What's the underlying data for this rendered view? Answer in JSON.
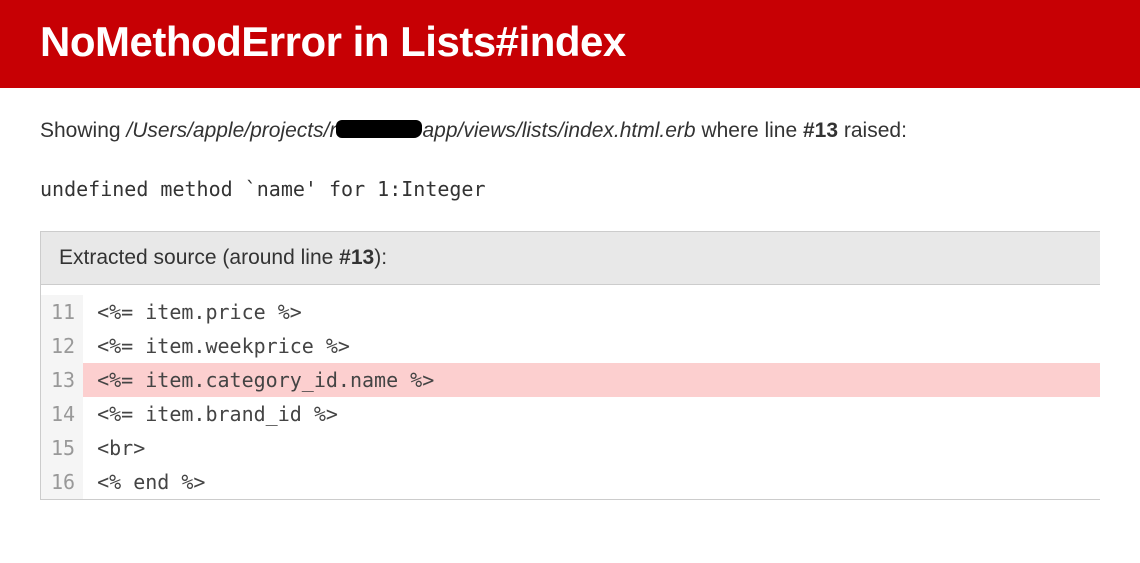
{
  "header": {
    "title": "NoMethodError in Lists#index"
  },
  "showing": {
    "prefix": "Showing ",
    "path_before": "/Users/apple/projects/r",
    "path_after": "app/views/lists/index.html.erb",
    "middle": " where line ",
    "line_ref": "#13",
    "suffix": " raised:"
  },
  "error_message": "undefined method `name' for 1:Integer",
  "source": {
    "header_prefix": "Extracted source (around line ",
    "header_line": "#13",
    "header_suffix": "):",
    "lines": [
      {
        "num": "11",
        "code": "<%= item.price %>",
        "highlighted": false
      },
      {
        "num": "12",
        "code": "<%= item.weekprice %>",
        "highlighted": false
      },
      {
        "num": "13",
        "code": "<%= item.category_id.name %>",
        "highlighted": true
      },
      {
        "num": "14",
        "code": "<%= item.brand_id %>",
        "highlighted": false
      },
      {
        "num": "15",
        "code": "<br>",
        "highlighted": false
      },
      {
        "num": "16",
        "code": "<% end %>",
        "highlighted": false
      }
    ]
  }
}
